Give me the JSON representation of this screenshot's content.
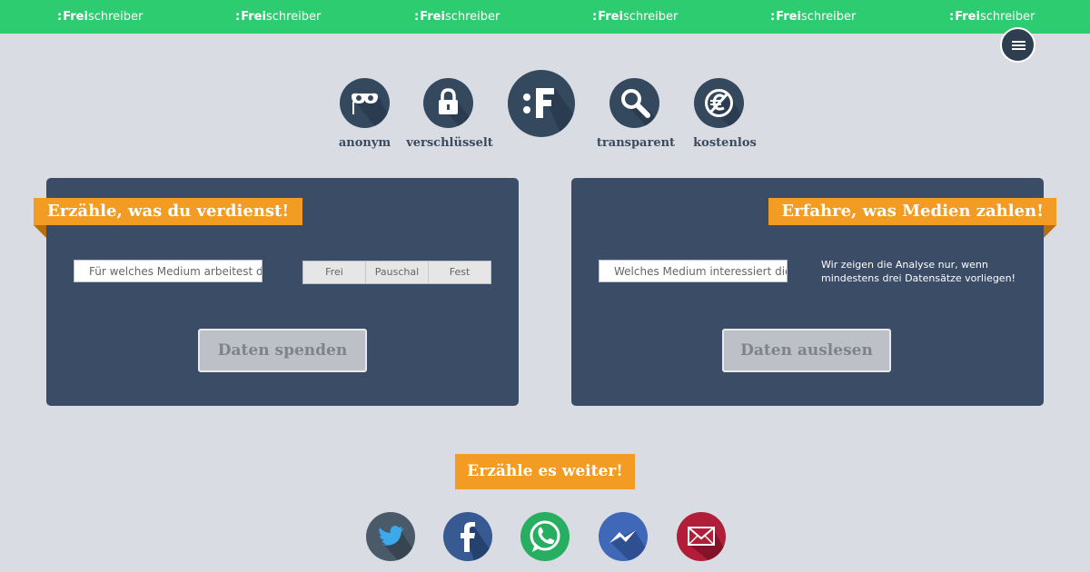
{
  "header": {
    "brand_prefix": ":",
    "brand_bold": "Frei",
    "brand_rest": "schreiber",
    "menu_icon": "hamburger-menu-icon",
    "accent_color": "#2ecc71"
  },
  "features": [
    {
      "label": "anonym",
      "icon": "mask-icon"
    },
    {
      "label": "verschlüsselt",
      "icon": "padlock-icon"
    },
    {
      "label": "",
      "icon": "freischreiber-logo-icon"
    },
    {
      "label": "transparent",
      "icon": "magnifier-icon"
    },
    {
      "label": "kostenlos",
      "icon": "no-euro-icon"
    }
  ],
  "donate": {
    "ribbon": "Erzähle, was du verdienst!",
    "medium_placeholder": "Für welches Medium arbeitest du?",
    "employment_options": [
      "Frei",
      "Pauschal",
      "Fest"
    ],
    "submit_label": "Daten spenden"
  },
  "read": {
    "ribbon": "Erfahre, was Medien zahlen!",
    "medium_placeholder": "Welches Medium interessiert dich?",
    "note": "Wir zeigen die Analyse nur, wenn mindestens drei Datensätze vorliegen!",
    "submit_label": "Daten auslesen"
  },
  "share": {
    "title": "Erzähle es weiter!",
    "networks": [
      {
        "icon": "twitter-icon",
        "color": "#4a5a68"
      },
      {
        "icon": "facebook-icon",
        "color": "#375a93"
      },
      {
        "icon": "whatsapp-icon",
        "color": "#27ae60"
      },
      {
        "icon": "messenger-icon",
        "color": "#3f68b8"
      },
      {
        "icon": "email-icon",
        "color": "#b01e3a"
      }
    ]
  },
  "colors": {
    "background": "#d9dce3",
    "panel": "#3a4c66",
    "ribbon": "#f39c23",
    "icon_circle": "#34495e"
  }
}
